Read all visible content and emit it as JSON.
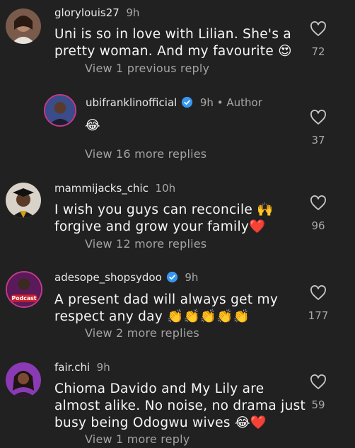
{
  "comments": [
    {
      "username": "glorylouis27",
      "time": "9h",
      "lines": [
        "Uni is so in love with Lilian. She's a",
        "pretty woman. And my favourite 😍"
      ],
      "likes": "72",
      "replies_link": "View 1 previous reply"
    },
    {
      "username": "ubifranklinofficial",
      "time": "9h",
      "author_badge": "• Author",
      "lines": [
        "😂"
      ],
      "likes": "37",
      "replies_link": "View 16 more replies"
    },
    {
      "username": "mammijacks_chic",
      "time": "10h",
      "lines": [
        "I wish you guys can reconcile 🙌",
        "forgive and grow your family❤️"
      ],
      "likes": "96",
      "replies_link": "View 12 more replies"
    },
    {
      "username": "adesope_shopsydoo",
      "time": "9h",
      "avatar_text": "Podcast",
      "lines": [
        "A present dad will always get my",
        "respect any day 👏👏👏👏👏"
      ],
      "likes": "177",
      "replies_link": "View 2 more replies"
    },
    {
      "username": "fair.chi",
      "time": "9h",
      "lines": [
        "Chioma Davido and My Lily are",
        "almost alike.  No noise, no drama just",
        "busy being Odogwu wives 😂❤️"
      ],
      "likes": "59",
      "replies_link": "View 1 more reply"
    }
  ],
  "colors": {
    "background": "#212121",
    "verified": "#3797f0",
    "muted": "#a8a8a8"
  },
  "icons": {
    "like": "heart-outline-icon",
    "verified": "verified-badge-icon"
  }
}
